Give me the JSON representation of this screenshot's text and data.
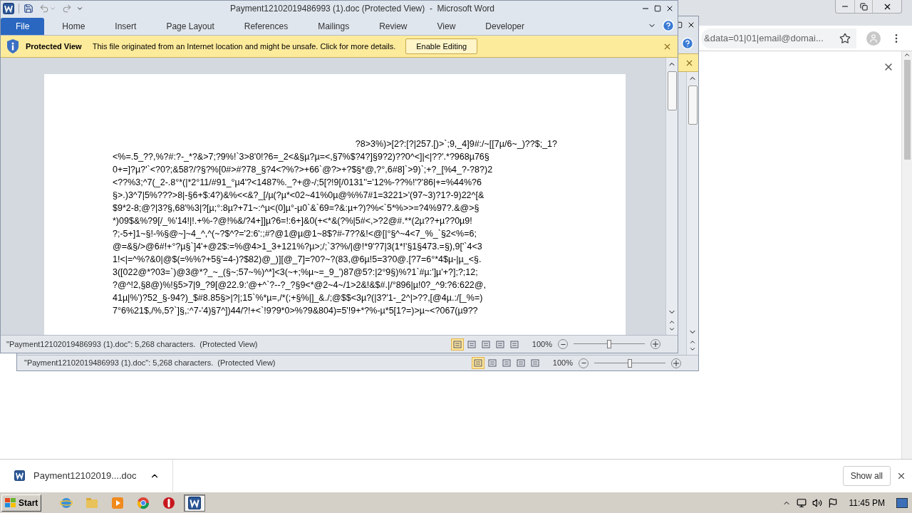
{
  "browser": {
    "address": "&data=01|01|email@domai..."
  },
  "back_window": {
    "view_buttons": [
      {
        "selected": true
      },
      {
        "selected": false
      },
      {
        "selected": false
      },
      {
        "selected": false
      },
      {
        "selected": false
      }
    ],
    "status_bar": {
      "text": "\"Payment12102019486993 (1).doc\": 5,268 characters.  (Protected View)",
      "zoom": "100%",
      "level": 0.5
    }
  },
  "word_window": {
    "title": "Payment12102019486993 (1).doc (Protected View)  -  Microsoft Word",
    "tabs": [
      {
        "label": "File",
        "selected": true
      },
      {
        "label": "Home",
        "selected": false
      },
      {
        "label": "Insert",
        "selected": false
      },
      {
        "label": "Page Layout",
        "selected": false
      },
      {
        "label": "References",
        "selected": false
      },
      {
        "label": "Mailings",
        "selected": false
      },
      {
        "label": "Review",
        "selected": false
      },
      {
        "label": "View",
        "selected": false
      },
      {
        "label": "Developer",
        "selected": false
      }
    ],
    "protected_view": {
      "label": "Protected View",
      "message": "This file originated from an Internet location and might be unsafe. Click for more details.",
      "button": "Enable Editing"
    },
    "document": {
      "lines": [
        "?8>3%)>[2?:[?|257.[)>`;9,_4]9#:/~[[7µ/6~_)??$;_1?",
        "<%=.5_??,%?#:?-_*?&>7;?9%!`3>8'0!?6=_2<&§µ?µ=<,§7%$?4?]§9?2)??0^<]|<|??'.*?968µ76§",
        "0+=]?µ?'`<?0?;&58?/?§?%[0#>#?78_§?4<?%?>+66`@?>+?$§*@,?°,6#8]`>9)`;+?_[%4_?-?8?)2",
        "<??%3;^7(_2-.8°*(|*2°11/#91_°µ4'?<1487%._?+@-/;5[?!9[/0131''='12%-??%!'?'86|+=%44%?6",
        "§>.)3^7|5%???>8|-§6+$:4?)&%<<&?_[/µ(?µ*<02~41%0µ@%%7#1=3221>'(97~3)?1?-9)22^[&",
        "$9*2-8;@?|3?§,68'%3|?[µ;°:8µ?+71~:^µ<(0]µ°-µ0`&`69=?&:µ+?)?%<`5*%>>=?4%97?.&@>§",
        "*)09$&%?9[/_%'14!|!.+%-?@!%&/?4+]]µ?6=!:6+]&0(+<*&(?%|5#<,>?2@#.**(2µ??+µ??0µ9!",
        "?;-5+]1~§!-%§@~]~4_^,^(~?$^?='2:6':;#?@1@µ@1~8$?#-7??&!<@[|°§^~4<7_%_`§2<%=6;",
        "@=&§/>@6#!+°?µ§`]4'+@2$:=%@4>1_3+121%?µ>;/;`3?%/|@!*9'?7|3(1*!'§1§473.=§),9['`4<3",
        "1!<|=^%?&0|@$(=%%?+5§'=4-)?$82)@_)][@_7]=?0?~?(83,@6µ!5=3?0@.[?7=6°*4$µ-|µ_<§.",
        "3([022@*?03=`)@3@*?_~_(§~;57~%)^*]<3(~+;%µ~=_9_')87@5?:|2°9§)%?1`#µ:']µ'+?];?;12;",
        "?@^!2,§8@)%!§5>7|9_?9[@22.9:'@+^`?--?_?§9<*@2~4~/1>2&!&$#.|/°896|µ!0?_^9:?6:622@,",
        "41µ|%')?52_§-94?)_$#8.85§>|?|;15`%*µ=,/*(;+§%|]_&./;@$$<3µ?(|3?'1-_2^|>??,[@4µ.:/[_%=)",
        "7°6%21$,/%,5?`]§,:^7-'4)§7^])44/?!+<`!9?9*0>%?9&804)=5'!9+*?%-µ*5[1?=)>µ~<?067(µ9??"
      ]
    },
    "view_buttons": [
      {
        "selected": true
      },
      {
        "selected": false
      },
      {
        "selected": false
      },
      {
        "selected": false
      },
      {
        "selected": false
      }
    ],
    "status_bar": {
      "text": "\"Payment12102019486993 (1).doc\": 5,268 characters.  (Protected View)",
      "zoom": "100%",
      "level": 0.5
    }
  },
  "download_bar": {
    "file": "Payment12102019....doc",
    "show_all": "Show all"
  },
  "taskbar": {
    "start": "Start",
    "apps": [
      {
        "kind": "ie",
        "selected": false
      },
      {
        "kind": "folder",
        "selected": false
      },
      {
        "kind": "media",
        "selected": false
      },
      {
        "kind": "chrome",
        "selected": false
      },
      {
        "kind": "stop",
        "selected": false
      },
      {
        "kind": "word",
        "selected": true
      }
    ],
    "clock": "11:45 PM"
  }
}
